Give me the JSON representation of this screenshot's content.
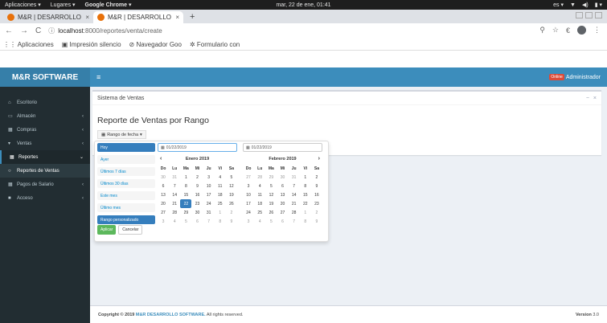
{
  "os": {
    "apps": "Aplicaciones",
    "places": "Lugares",
    "browser": "Google Chrome",
    "clock": "mar, 22 de ene, 01:41",
    "lang": "es"
  },
  "tabs": [
    {
      "label": "M&R | DESARROLLO DE"
    },
    {
      "label": "M&R | DESARROLLO DE"
    }
  ],
  "address": {
    "host": "localhost",
    "path": ":8000/reportes/venta/create"
  },
  "bookmarks": [
    "Aplicaciones",
    "Impresión silencio",
    "Navegador Goo",
    "Formulario con"
  ],
  "header": {
    "brand": "M&R SOFTWARE",
    "toggle": "≡",
    "online": "Online",
    "user": "Administrador"
  },
  "sidebar": {
    "items": [
      {
        "icon": "⌂",
        "label": "Escritorio"
      },
      {
        "icon": "▭",
        "label": "Almacén"
      },
      {
        "icon": "▦",
        "label": "Compras"
      },
      {
        "icon": "▾",
        "label": "Ventas"
      },
      {
        "icon": "▦",
        "label": "Reportes"
      },
      {
        "icon": "○",
        "label": "Reportes de Ventas"
      },
      {
        "icon": "▦",
        "label": "Pagos de Salario"
      },
      {
        "icon": "■",
        "label": "Acceso"
      }
    ]
  },
  "box": {
    "title": "Sistema de Ventas",
    "report_title": "Reporte de Ventas por Rango",
    "range_button": "Rango de fecha"
  },
  "picker": {
    "ranges": [
      "Hoy",
      "Ayer",
      "Últimos 7 días",
      "Últimos 30 días",
      "Este mes",
      "Último mes",
      "Rango personalizado"
    ],
    "apply": "Aplicar",
    "cancel": "Cancelar",
    "start_input": "01/22/2019",
    "end_input": "01/22/2019",
    "weekdays": [
      "Do",
      "Lu",
      "Ma",
      "Mi",
      "Ju",
      "Vi",
      "Sa"
    ],
    "left_month": "Enero 2019",
    "right_month": "Febrero 2019",
    "left_weeks": [
      [
        "30",
        "31",
        "1",
        "2",
        "3",
        "4",
        "5"
      ],
      [
        "6",
        "7",
        "8",
        "9",
        "10",
        "11",
        "12"
      ],
      [
        "13",
        "14",
        "15",
        "16",
        "17",
        "18",
        "19"
      ],
      [
        "20",
        "21",
        "22",
        "23",
        "24",
        "25",
        "26"
      ],
      [
        "27",
        "28",
        "29",
        "30",
        "31",
        "1",
        "2"
      ],
      [
        "3",
        "4",
        "5",
        "6",
        "7",
        "8",
        "9"
      ]
    ],
    "right_weeks": [
      [
        "27",
        "28",
        "29",
        "30",
        "31",
        "1",
        "2"
      ],
      [
        "3",
        "4",
        "5",
        "6",
        "7",
        "8",
        "9"
      ],
      [
        "10",
        "11",
        "12",
        "13",
        "14",
        "15",
        "16"
      ],
      [
        "17",
        "18",
        "19",
        "20",
        "21",
        "22",
        "23"
      ],
      [
        "24",
        "25",
        "26",
        "27",
        "28",
        "1",
        "2"
      ],
      [
        "3",
        "4",
        "5",
        "6",
        "7",
        "8",
        "9"
      ]
    ],
    "selected_day": "22"
  },
  "footer": {
    "copyright": "Copyright © 2019",
    "company": "M&R DESARROLLO SOFTWARE.",
    "rights": "All rights reserved.",
    "version_label": "Version",
    "version": "3.0"
  }
}
